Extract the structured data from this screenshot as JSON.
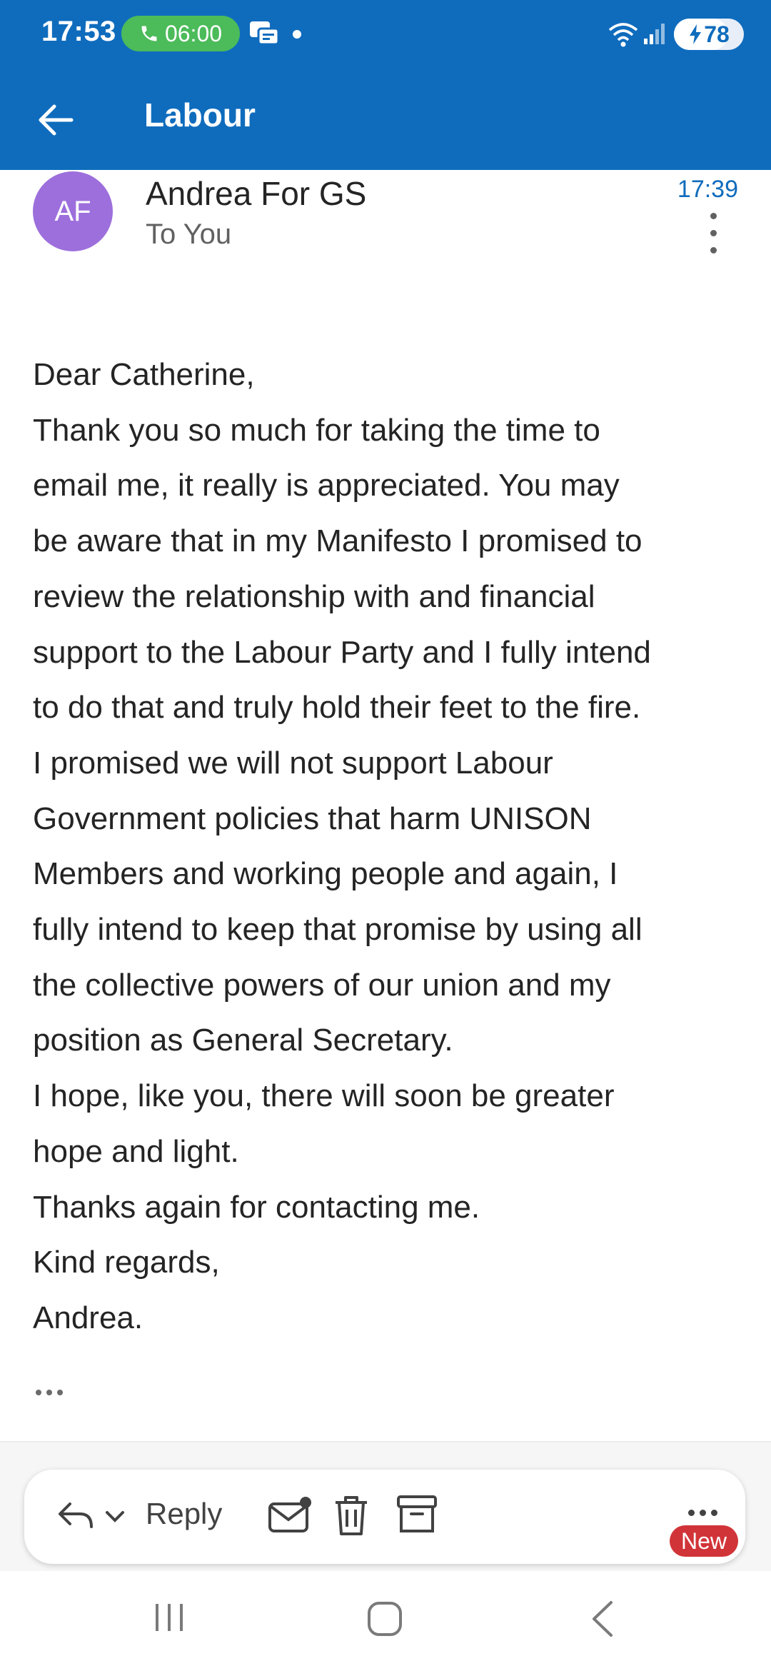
{
  "status_bar": {
    "time": "17:53",
    "call_duration": "06:00",
    "battery_level": "78",
    "battery_fraction": 0.78,
    "icons": [
      "phone-icon",
      "message-icon",
      "wifi-icon",
      "signal-icon",
      "battery-charging-icon"
    ]
  },
  "header": {
    "folder_title": "Labour",
    "back_icon": "arrow-left-icon"
  },
  "email": {
    "avatar_initials": "AF",
    "avatar_color": "#9d6fdc",
    "sender": "Andrea For GS",
    "recipient": "To You",
    "time": "17:39",
    "body_lines": [
      "Dear Catherine,",
      "Thank you so much for taking the time to",
      "email me, it really is appreciated. You may",
      "be aware that in my Manifesto I promised to",
      "review the relationship with and financial",
      "support to the Labour Party and I fully intend",
      "to do that and truly hold their feet to the fire.",
      "I promised we will not support Labour",
      "Government policies that harm UNISON",
      "Members and working people and again, I",
      "fully intend to keep that promise by using all",
      "the collective powers of our union and my",
      "position as General Secretary.",
      "I hope, like you, there will soon be greater",
      "hope and light.",
      "Thanks again for contacting me.",
      "Kind regards,",
      "Andrea."
    ]
  },
  "action_bar": {
    "reply_label": "Reply",
    "new_badge": "New",
    "icons": [
      "reply-icon",
      "mark-unread-icon",
      "delete-icon",
      "archive-icon",
      "more-icon"
    ]
  },
  "system_nav": {
    "icons": [
      "recent-apps-icon",
      "home-icon",
      "back-icon"
    ]
  },
  "colors": {
    "header_bg": "#0f6cbd",
    "accent": "#0f6cbd",
    "call_pill": "#4cbb5a",
    "badge": "#d13438"
  }
}
